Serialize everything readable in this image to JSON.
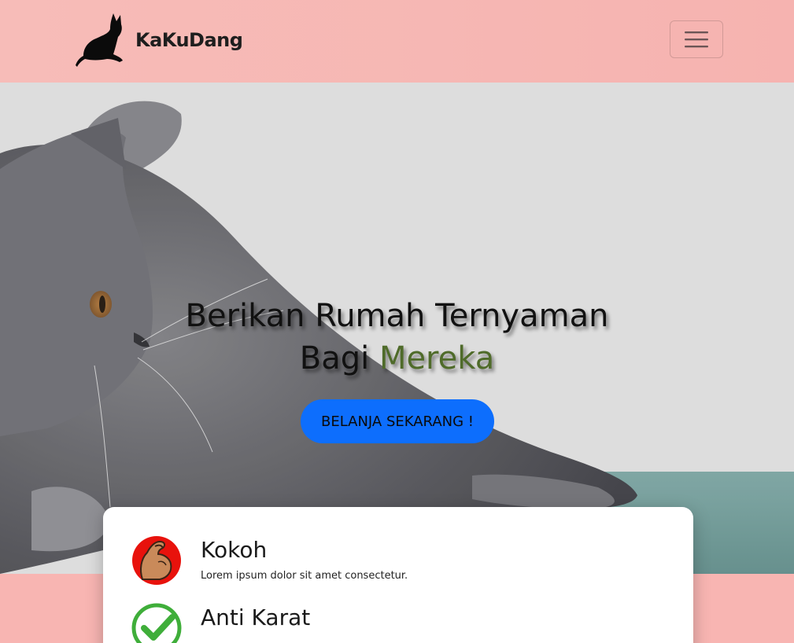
{
  "navbar": {
    "brand_name": "KaKuDang",
    "logo_icon": "black-cat-silhouette-icon",
    "toggler_icon": "hamburger-menu-icon"
  },
  "hero": {
    "title_line1": "Berikan Rumah Ternyaman",
    "title_line2_prefix": "Bagi ",
    "title_line2_accent": "Mereka",
    "cta_label": "BELANJA SEKARANG !",
    "background_image": "grey-cat-lying-photo"
  },
  "features": [
    {
      "title": "Kokoh",
      "description": "Lorem ipsum dolor sit amet consectetur.",
      "icon": "flexed-arm-icon"
    },
    {
      "title": "Anti Karat",
      "description": "",
      "icon": "green-check-icon"
    }
  ],
  "colors": {
    "navbar_bg": "#f6b3b0",
    "page_bg": "#f8b5b2",
    "cta_bg": "#0d6efd",
    "accent_text": "#4f6b2a"
  }
}
